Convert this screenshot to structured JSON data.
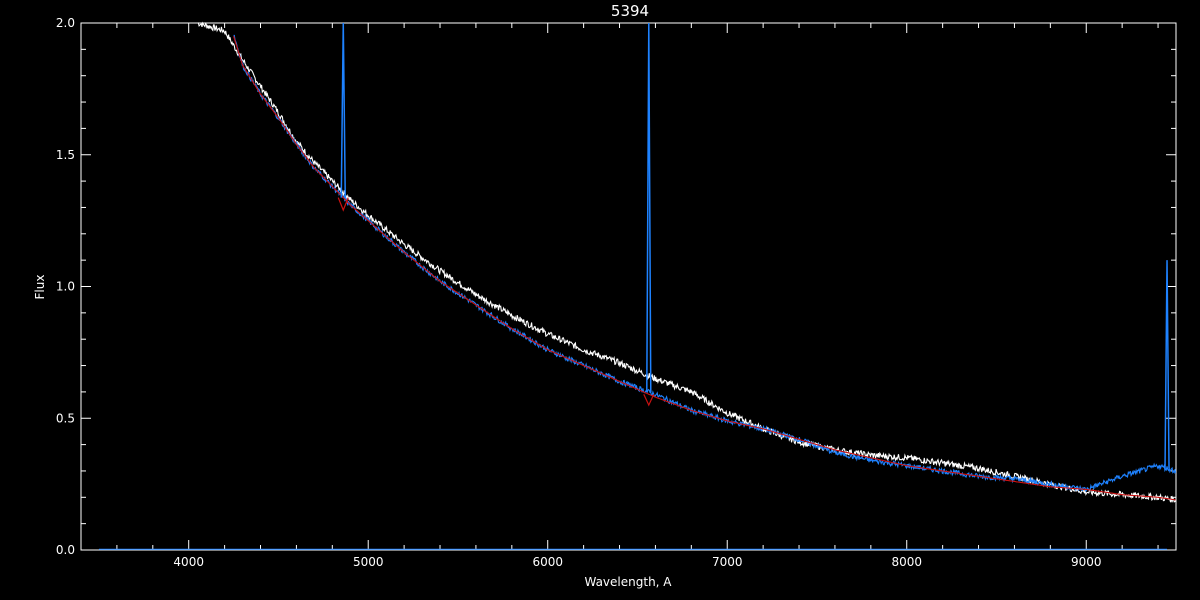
{
  "chart_data": {
    "type": "line",
    "title": "5394",
    "xlabel": "Wavelength, A",
    "ylabel": "Flux",
    "xlim": [
      3400,
      9500
    ],
    "ylim": [
      0.0,
      2.0
    ],
    "x_ticks": [
      4000,
      5000,
      6000,
      7000,
      8000,
      9000
    ],
    "x_tick_labels": [
      "4000",
      "5000",
      "6000",
      "7000",
      "8000",
      "9000"
    ],
    "y_ticks": [
      0.0,
      0.5,
      1.0,
      1.5,
      2.0
    ],
    "y_tick_labels": [
      "0.0",
      "0.5",
      "1.0",
      "1.5",
      "2.0"
    ],
    "grid": false,
    "background": "#000000",
    "series": [
      {
        "color": "#ffffff",
        "x": [
          4050,
          4100,
          4200,
          4300,
          4400,
          4500,
          4600,
          4700,
          4800,
          4900,
          5000,
          5200,
          5400,
          5600,
          5800,
          6000,
          6200,
          6400,
          6600,
          6800,
          7000,
          7200,
          7400,
          7600,
          7800,
          8000,
          8200,
          8400,
          8600,
          8800,
          9000,
          9200,
          9400,
          9500
        ],
        "y": [
          2.0,
          1.99,
          1.97,
          1.86,
          1.76,
          1.66,
          1.55,
          1.47,
          1.4,
          1.33,
          1.27,
          1.16,
          1.06,
          0.97,
          0.89,
          0.82,
          0.76,
          0.71,
          0.65,
          0.6,
          0.52,
          0.46,
          0.41,
          0.38,
          0.36,
          0.35,
          0.33,
          0.31,
          0.28,
          0.25,
          0.22,
          0.21,
          0.2,
          0.19
        ]
      },
      {
        "color": "#1e82ff",
        "x": [
          4250,
          4300,
          4400,
          4500,
          4600,
          4700,
          4800,
          4900,
          5000,
          5200,
          5400,
          5600,
          5800,
          6000,
          6200,
          6400,
          6600,
          6800,
          7000,
          7200,
          7400,
          7600,
          7800,
          8000,
          8200,
          8400,
          8600,
          8800,
          9000,
          9200,
          9400,
          9500
        ],
        "y": [
          1.96,
          1.84,
          1.73,
          1.64,
          1.54,
          1.45,
          1.38,
          1.31,
          1.25,
          1.13,
          1.02,
          0.93,
          0.84,
          0.76,
          0.7,
          0.64,
          0.59,
          0.53,
          0.49,
          0.46,
          0.42,
          0.37,
          0.34,
          0.32,
          0.3,
          0.28,
          0.27,
          0.25,
          0.23,
          0.28,
          0.32,
          0.3
        ]
      },
      {
        "color": "#cc1111",
        "x": [
          4250,
          4300,
          4400,
          4500,
          4600,
          4700,
          4800,
          4900,
          5000,
          5200,
          5400,
          5600,
          5800,
          6000,
          6200,
          6400,
          6600,
          6800,
          7000,
          7200,
          7400,
          7600,
          7800,
          8000,
          8200,
          8400,
          8600,
          8800,
          9000,
          9200,
          9400,
          9500
        ],
        "y": [
          1.95,
          1.84,
          1.73,
          1.64,
          1.54,
          1.45,
          1.38,
          1.31,
          1.25,
          1.13,
          1.02,
          0.93,
          0.84,
          0.76,
          0.7,
          0.64,
          0.58,
          0.53,
          0.49,
          0.46,
          0.42,
          0.38,
          0.35,
          0.32,
          0.3,
          0.28,
          0.26,
          0.24,
          0.23,
          0.21,
          0.2,
          0.19
        ]
      }
    ],
    "annotations": [
      {
        "type": "emission_peak",
        "color": "#1e82ff",
        "x": 4861,
        "y": 2.0
      },
      {
        "type": "emission_peak",
        "color": "#1e82ff",
        "x": 6563,
        "y": 2.0
      },
      {
        "type": "emission_peak",
        "color": "#1e82ff",
        "x": 9450,
        "y": 1.1
      },
      {
        "type": "absorption_dip",
        "color": "#cc1111",
        "x": 4861,
        "y": 1.29
      },
      {
        "type": "absorption_dip",
        "color": "#cc1111",
        "x": 6563,
        "y": 0.55
      }
    ]
  }
}
